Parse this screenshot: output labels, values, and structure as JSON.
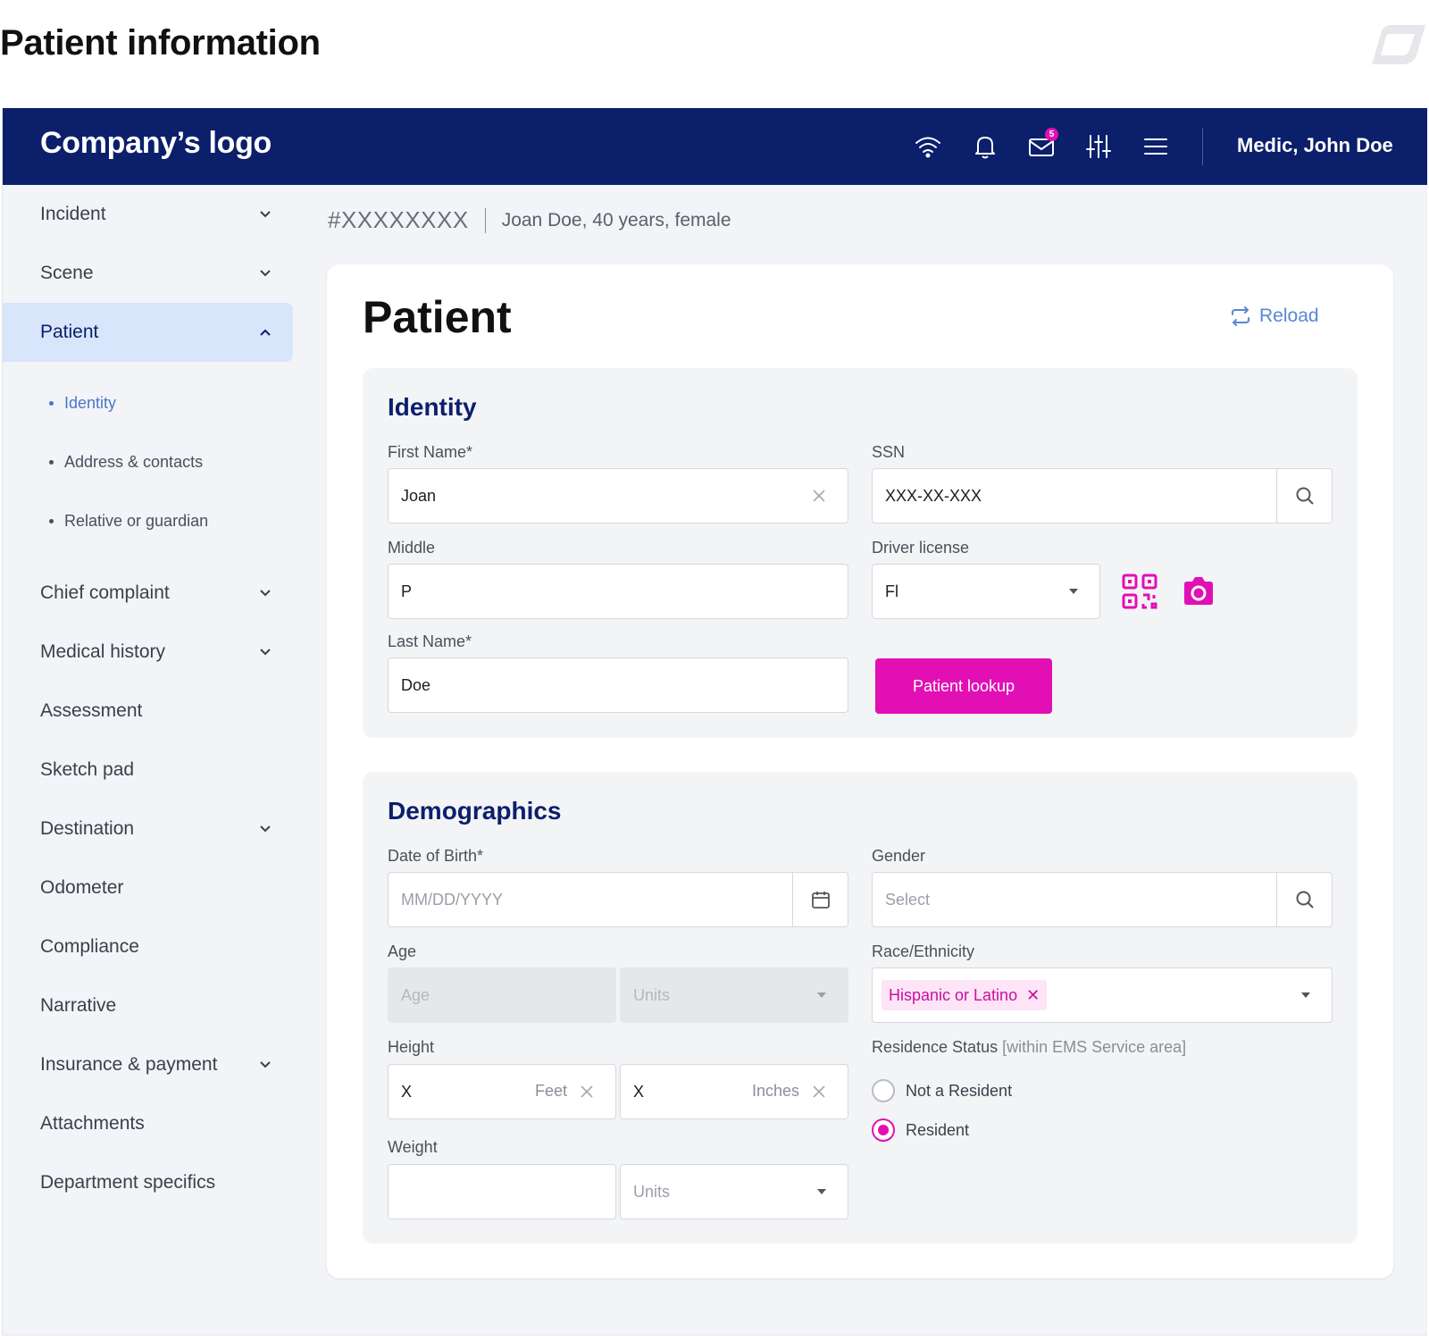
{
  "page_heading": "Patient information",
  "header": {
    "logo": "Company’s logo",
    "user": "Medic, John Doe",
    "mail_count": "5",
    "icons": [
      "wifi-icon",
      "bell-icon",
      "mail-icon",
      "sliders-icon",
      "menu-icon"
    ]
  },
  "sidebar": {
    "items": [
      {
        "label": "Incident"
      },
      {
        "label": "Scene"
      },
      {
        "label": "Patient"
      },
      {
        "label": "Chief complaint"
      },
      {
        "label": "Medical history"
      },
      {
        "label": "Assessment"
      },
      {
        "label": "Sketch pad"
      },
      {
        "label": "Destination"
      },
      {
        "label": "Odometer"
      },
      {
        "label": "Compliance"
      },
      {
        "label": "Narrative"
      },
      {
        "label": "Insurance & payment"
      },
      {
        "label": "Attachments"
      },
      {
        "label": "Department specifics"
      }
    ],
    "sub_items": [
      {
        "label": "Identity"
      },
      {
        "label": "Address & contacts"
      },
      {
        "label": "Relative or guardian"
      }
    ]
  },
  "breadcrumb": {
    "id": "#XXXXXXXX",
    "info": "Joan Doe, 40 years, female"
  },
  "card": {
    "title": "Patient",
    "reload_label": "Reload"
  },
  "identity": {
    "title": "Identity",
    "first_name_label": "First Name*",
    "first_name_value": "Joan",
    "ssn_label": "SSN",
    "ssn_value": "XXX-XX-XXX",
    "middle_label": "Middle",
    "middle_value": "P",
    "driver_license_label": "Driver license",
    "driver_license_value": "Fl",
    "last_name_label": "Last Name*",
    "last_name_value": "Doe",
    "lookup_button": "Patient lookup"
  },
  "demographics": {
    "title": "Demographics",
    "dob_label": "Date of Birth*",
    "dob_placeholder": "MM/DD/YYYY",
    "gender_label": "Gender",
    "gender_placeholder": "Select",
    "age_label": "Age",
    "age_placeholder": "Age",
    "age_units_placeholder": "Units",
    "race_label": "Race/Ethnicity",
    "race_chip": "Hispanic or Latino",
    "height_label": "Height",
    "height_feet_value": "X",
    "height_feet_unit": "Feet",
    "height_inches_value": "X",
    "height_inches_unit": "Inches",
    "residence_label": "Residence Status",
    "residence_note": "[within EMS Service area]",
    "residence_options": [
      {
        "label": "Not a Resident",
        "checked": false
      },
      {
        "label": "Resident",
        "checked": true
      }
    ],
    "weight_label": "Weight",
    "weight_value": "",
    "weight_units_placeholder": "Units"
  },
  "colors": {
    "navy": "#0b1f6b",
    "accent": "#e20fb5",
    "link": "#5a86d6",
    "active_bg": "#d8e5fb"
  }
}
